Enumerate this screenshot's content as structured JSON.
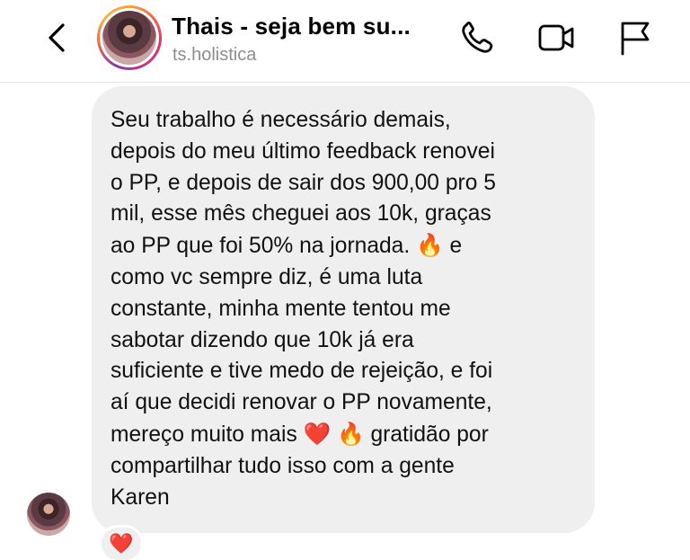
{
  "header": {
    "title": "Thais - seja bem su...",
    "username": "ts.holistica",
    "icons": {
      "back": "chevron-left-icon",
      "call": "phone-icon",
      "video": "video-camera-icon",
      "report": "flag-icon"
    }
  },
  "message": {
    "text": "Seu trabalho é necessário demais,\ndepois do meu último feedback renovei\no PP, e depois de sair dos 900,00 pro 5\nmil, esse mês cheguei aos 10k, graças\nao PP  que foi 50% na jornada.",
    "fire_emoji": "🔥",
    "text_2": " e\ncomo vc sempre diz, é uma luta\nconstante, minha mente tentou me\nsabotar dizendo que 10k já era\nsuficiente e tive medo de rejeição, e foi\naí que decidi renovar o PP novamente,\nmereço muito mais ",
    "heart_emoji": "❤️",
    "fire_emoji_2": "🔥",
    "text_3": " gratidão por\ncompartilhar tudo isso com a gente\nKaren"
  },
  "reaction": {
    "emoji": "❤️"
  },
  "colors": {
    "bubble": "#efefef",
    "subtitle": "#8e8e8e",
    "story_ring": "#e1306c"
  }
}
